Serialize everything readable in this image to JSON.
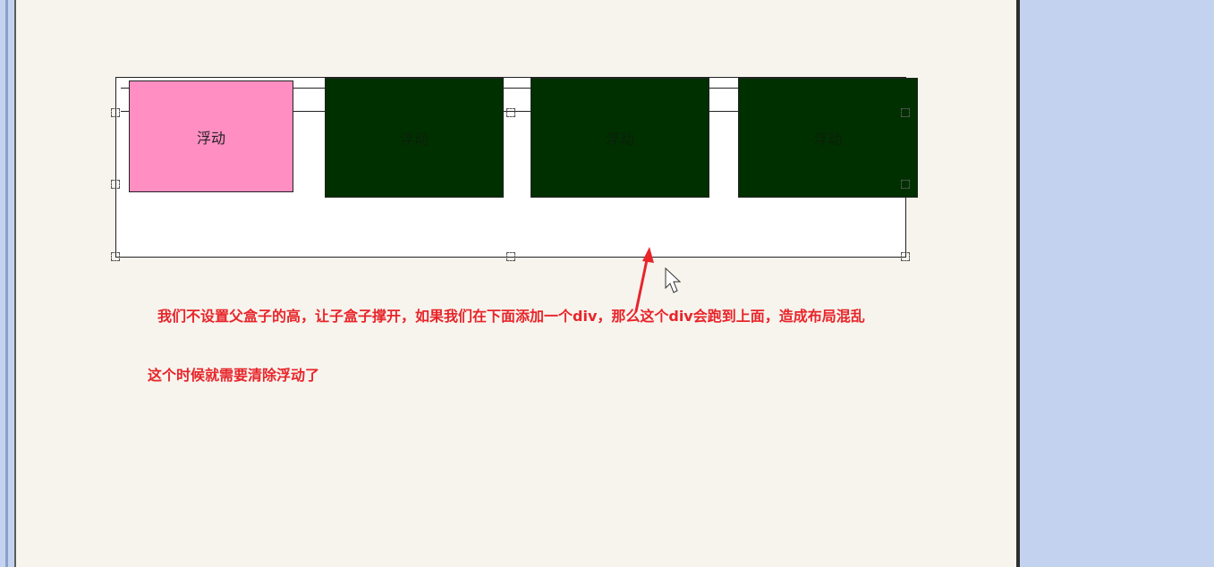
{
  "float_label": "浮动",
  "boxes": [
    {
      "label": "浮动",
      "color": "#ff8ec2"
    },
    {
      "label": "浮动",
      "color": "#003000"
    },
    {
      "label": "浮动",
      "color": "#003000"
    },
    {
      "label": "浮动",
      "color": "#003000"
    }
  ],
  "notes": {
    "line1": "我们不设置父盒子的高，让子盒子撑开，如果我们在下面添加一个div，那么这个div会跑到上面，造成布局混乱",
    "line2": "这个时候就需要清除浮动了"
  },
  "colors": {
    "annotation_red": "#e8252a",
    "frame_blue": "#c3d3ef",
    "canvas": "#f7f4ee"
  },
  "icons": {
    "cursor": "mouse-pointer-icon",
    "arrow": "red-arrow-icon"
  }
}
